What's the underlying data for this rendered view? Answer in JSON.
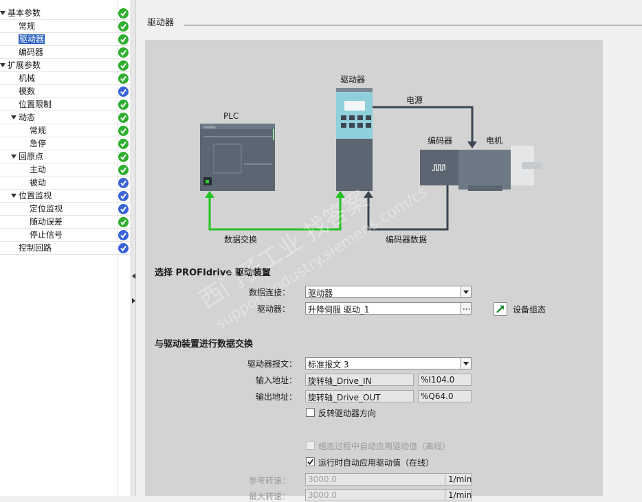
{
  "tree": {
    "items": [
      {
        "label": "基本参数",
        "status": "green",
        "expanded": true
      },
      {
        "label": "常规",
        "status": "green"
      },
      {
        "label": "驱动器",
        "status": "green",
        "selected": true
      },
      {
        "label": "编码器",
        "status": "green"
      },
      {
        "label": "扩展参数",
        "status": "green",
        "expanded": true
      },
      {
        "label": "机械",
        "status": "green"
      },
      {
        "label": "模数",
        "status": "blue"
      },
      {
        "label": "位置限制",
        "status": "green"
      },
      {
        "label": "动态",
        "status": "green",
        "expanded": true
      },
      {
        "label": "常规",
        "status": "green"
      },
      {
        "label": "急停",
        "status": "green"
      },
      {
        "label": "回原点",
        "status": "green",
        "expanded": true
      },
      {
        "label": "主动",
        "status": "green"
      },
      {
        "label": "被动",
        "status": "blue"
      },
      {
        "label": "位置监视",
        "status": "blue",
        "expanded": true
      },
      {
        "label": "定位监视",
        "status": "blue"
      },
      {
        "label": "随动误差",
        "status": "green"
      },
      {
        "label": "停止信号",
        "status": "blue"
      },
      {
        "label": "控制回路",
        "status": "blue"
      }
    ]
  },
  "section_title": "驱动器",
  "diagram": {
    "plc_label": "PLC",
    "drive_label": "驱动器",
    "power_label": "电源",
    "encoder_label": "编码器",
    "motor_label": "电机",
    "data_exchange_label": "数据交换",
    "encoder_data_label": "编码器数据",
    "siemens_label": "SIEMENS"
  },
  "select_drive": {
    "heading": "选择 PROFIdrive 驱动装置",
    "data_connection_label": "数据连接：",
    "data_connection_value": "驱动器",
    "drive_label": "驱动器：",
    "drive_value": "升降伺服 驱动_1",
    "device_config_label": "设备组态"
  },
  "data_exchange": {
    "heading": "与驱动装置进行数据交换",
    "telegram_label": "驱动器报文：",
    "telegram_value": "标准报文 3",
    "input_label": "输入地址：",
    "input_name": "旋转轴_Drive_IN",
    "input_addr": "%I104.0",
    "output_label": "输出地址：",
    "output_name": "旋转轴_Drive_OUT",
    "output_addr": "%Q64.0",
    "reverse_label": "反转驱动器方向",
    "auto_apply_offline_label": "组态过程中自动应用驱动值（离线）",
    "auto_apply_online_label": "运行时自动应用驱动值（在线）",
    "ref_speed_label": "参考转速：",
    "ref_speed_value": "3000.0",
    "ref_speed_unit": "1/min",
    "max_speed_label": "最大转速：",
    "max_speed_value": "3000.0",
    "max_speed_unit": "1/min"
  },
  "watermark": {
    "line1": "西门子工业 找答案",
    "line2": "support.industry.siemens.com/cs"
  },
  "colors": {
    "check_green": "#2fae2f",
    "check_blue": "#3b63d6",
    "selection": "#2a5fbf",
    "green_arrow": "#22c322",
    "dark_arrow": "#3a4452"
  }
}
